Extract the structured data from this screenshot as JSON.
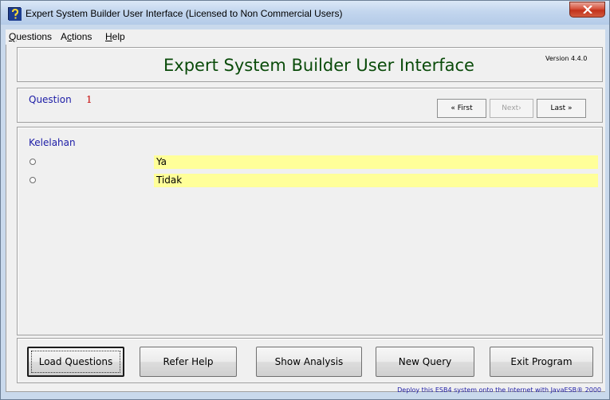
{
  "window": {
    "title": "Expert System Builder User Interface (Licensed to Non Commercial Users)",
    "icon": "question-help-icon",
    "close_icon": "close-icon"
  },
  "menu": {
    "items": [
      {
        "label": "Questions",
        "underline": "Q",
        "rest": "uestions"
      },
      {
        "label": "Actions",
        "underline_pre": "A",
        "underline": "c",
        "rest": "tions"
      },
      {
        "label": "Help",
        "underline": "H",
        "rest": "elp"
      }
    ]
  },
  "header": {
    "title": "Expert System Builder User Interface",
    "version": "Version 4.4.0"
  },
  "question": {
    "label": "Question",
    "number": "1",
    "nav": {
      "first": "« First",
      "next": "Next›",
      "last": "Last »",
      "next_enabled": false
    }
  },
  "attribute": {
    "name": "Kelelahan",
    "options": [
      {
        "label": "Ya",
        "selected": false
      },
      {
        "label": "Tidak",
        "selected": false
      }
    ]
  },
  "buttons": {
    "load": "Load Questions",
    "refer": "Refer Help",
    "analysis": "Show Analysis",
    "new_query": "New Query",
    "exit": "Exit Program"
  },
  "footer": {
    "text": "Deploy this ESB4 system onto the Internet with JavaESB® 2000"
  },
  "colors": {
    "title_green": "#0a4b0a",
    "label_blue": "#1c1ca6",
    "number_red": "#c40000",
    "option_highlight": "#ffff99"
  }
}
